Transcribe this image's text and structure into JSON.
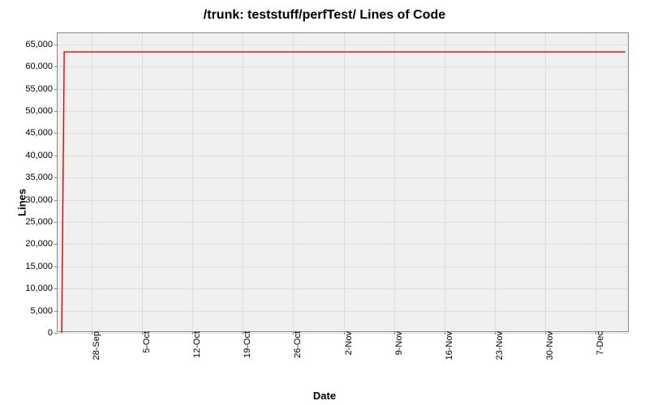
{
  "chart_data": {
    "type": "line",
    "title": "/trunk: teststuff/perfTest/ Lines of Code",
    "xlabel": "Date",
    "ylabel": "Lines",
    "ylim": [
      0,
      67500
    ],
    "y_ticks": [
      0,
      5000,
      10000,
      15000,
      20000,
      25000,
      30000,
      35000,
      40000,
      45000,
      50000,
      55000,
      60000,
      65000
    ],
    "y_tick_labels": [
      "0",
      "5,000",
      "10,000",
      "15,000",
      "20,000",
      "25,000",
      "30,000",
      "35,000",
      "40,000",
      "45,000",
      "50,000",
      "55,000",
      "60,000",
      "65,000"
    ],
    "x_categories": [
      "28-Sep",
      "5-Oct",
      "12-Oct",
      "19-Oct",
      "26-Oct",
      "2-Nov",
      "9-Nov",
      "16-Nov",
      "23-Nov",
      "30-Nov",
      "7-Dec"
    ],
    "series": [
      {
        "name": "Lines of Code",
        "color": "#e60000",
        "x": [
          "23-Sep",
          "24-Sep",
          "11-Dec"
        ],
        "values": [
          0,
          63300,
          63300
        ]
      }
    ]
  }
}
